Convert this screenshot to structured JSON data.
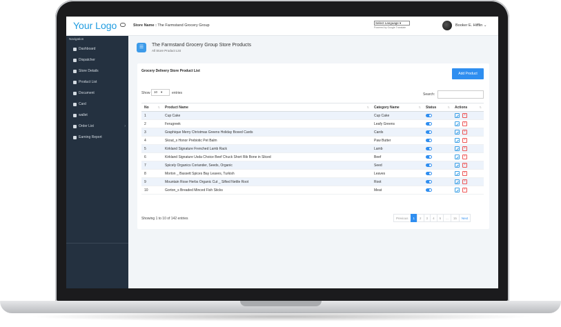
{
  "header": {
    "logo": "Your Logo",
    "store_label": "Store Name :",
    "store_name": "The Farmstand Grocery Group",
    "language_select": "Select Language",
    "powered_by": "Powered by Google Translate",
    "user_name": "Booker E. Hifflin"
  },
  "sidebar": {
    "heading": "Navigation",
    "items": [
      {
        "label": "Dashboard",
        "icon": "home-icon"
      },
      {
        "label": "Dispatcher",
        "icon": "clipboard-icon"
      },
      {
        "label": "Store Details",
        "icon": "store-icon"
      },
      {
        "label": "Product List",
        "icon": "list-icon"
      },
      {
        "label": "Document",
        "icon": "document-icon"
      },
      {
        "label": "Card",
        "icon": "card-icon"
      },
      {
        "label": "wallet",
        "icon": "wallet-icon"
      },
      {
        "label": "Order List",
        "icon": "order-icon"
      },
      {
        "label": "Earning Report",
        "icon": "report-icon"
      }
    ]
  },
  "page": {
    "title": "The Farmstand Grocery Group Store Products",
    "subtitle": "All Store Product List"
  },
  "card": {
    "title": "Grocery Delivery Store Product List",
    "add_button": "Add Product",
    "show_label": "Show",
    "page_size": "10",
    "entries_label": "entries",
    "search_label": "Search:"
  },
  "table": {
    "columns": [
      "No",
      "Product Name",
      "Category Name",
      "Status",
      "Actions"
    ],
    "rows": [
      {
        "no": "1",
        "name": "Cup Cake",
        "category": "Cup Cake"
      },
      {
        "no": "2",
        "name": "Ferugreek",
        "category": "Leafy Greens"
      },
      {
        "no": "3",
        "name": "Graphique Merry Christmas Greens Holiday Boxed Cards",
        "category": "Cards"
      },
      {
        "no": "4",
        "name": "Skout_s Honor Prebiotic Pet Balm",
        "category": "Paw Butter"
      },
      {
        "no": "5",
        "name": "Kirkland Signature Frenched Lamb Rack",
        "category": "Lamb"
      },
      {
        "no": "6",
        "name": "Kirkland Signature Usda Choice Beef Chuck Short Rib Bone in Sliced",
        "category": "Beef"
      },
      {
        "no": "7",
        "name": "Spicely Organics Coriander, Seeds, Organic",
        "category": "Seed"
      },
      {
        "no": "8",
        "name": "Morton _ Bassett Spices Bay Leaves, Turkish",
        "category": "Leaves"
      },
      {
        "no": "9",
        "name": "Mountain Rose Herbs Organic Cut _ Sifted Nettle Root",
        "category": "Root"
      },
      {
        "no": "10",
        "name": "Gorton_s Breaded Minced Fish Sticks",
        "category": "Meat"
      }
    ]
  },
  "footer": {
    "info": "Showing 1 to 10 of 142 entries",
    "pager": [
      "Previous",
      "1",
      "2",
      "3",
      "4",
      "5",
      "...",
      "15",
      "Next"
    ]
  }
}
